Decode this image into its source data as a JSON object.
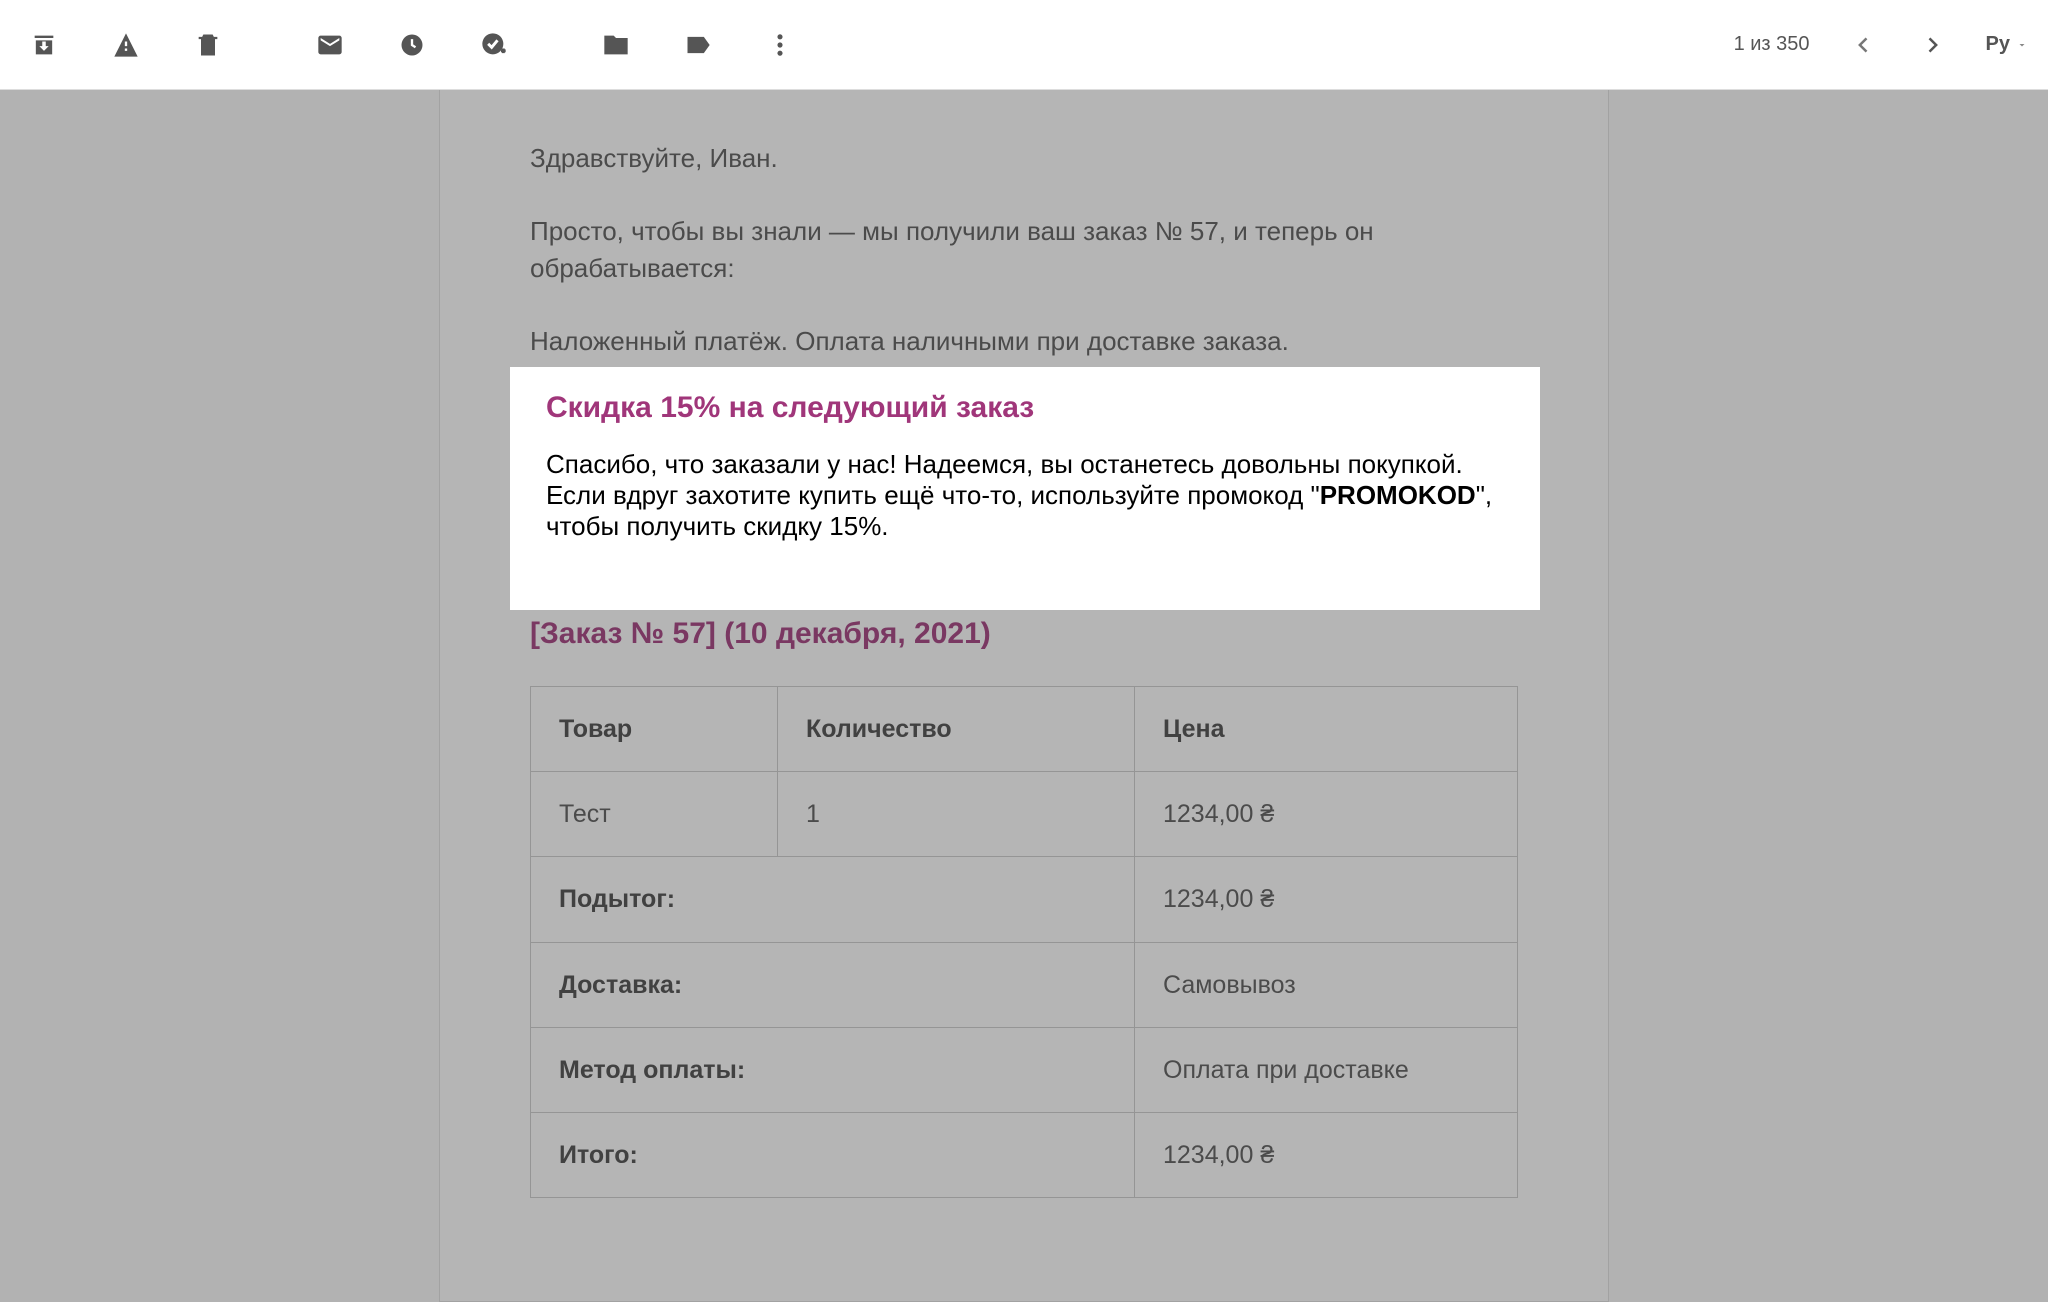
{
  "toolbar": {
    "pagination": "1 из 350",
    "lang": "Ру"
  },
  "email": {
    "greeting": "Здравствуйте, Иван.",
    "intro": "Просто, чтобы вы знали — мы получили ваш заказ № 57, и теперь он обрабатывается:",
    "payment_note": "Наложенный платёж. Оплата наличными при доставке заказа.",
    "promo": {
      "heading": "Скидка 15% на следующий заказ",
      "text_before": "Спасибо, что заказали у нас! Надеемся, вы останетесь довольны покупкой. Если вдруг захотите купить ещё что-то, используйте промокод \"",
      "code": "PROMOKOD",
      "text_after": "\", чтобы получить скидку 15%."
    },
    "order_heading": "[Заказ № 57] (10 декабря, 2021)",
    "table": {
      "headers": {
        "product": "Товар",
        "qty": "Количество",
        "price": "Цена"
      },
      "row": {
        "product": "Тест",
        "qty": "1",
        "price": "1234,00 ₴"
      },
      "subtotal_label": "Подытог:",
      "subtotal_value": "1234,00 ₴",
      "shipping_label": "Доставка:",
      "shipping_value": "Самовывоз",
      "payment_label": "Метод оплаты:",
      "payment_value": "Оплата при доставке",
      "total_label": "Итого:",
      "total_value": "1234,00 ₴"
    }
  }
}
